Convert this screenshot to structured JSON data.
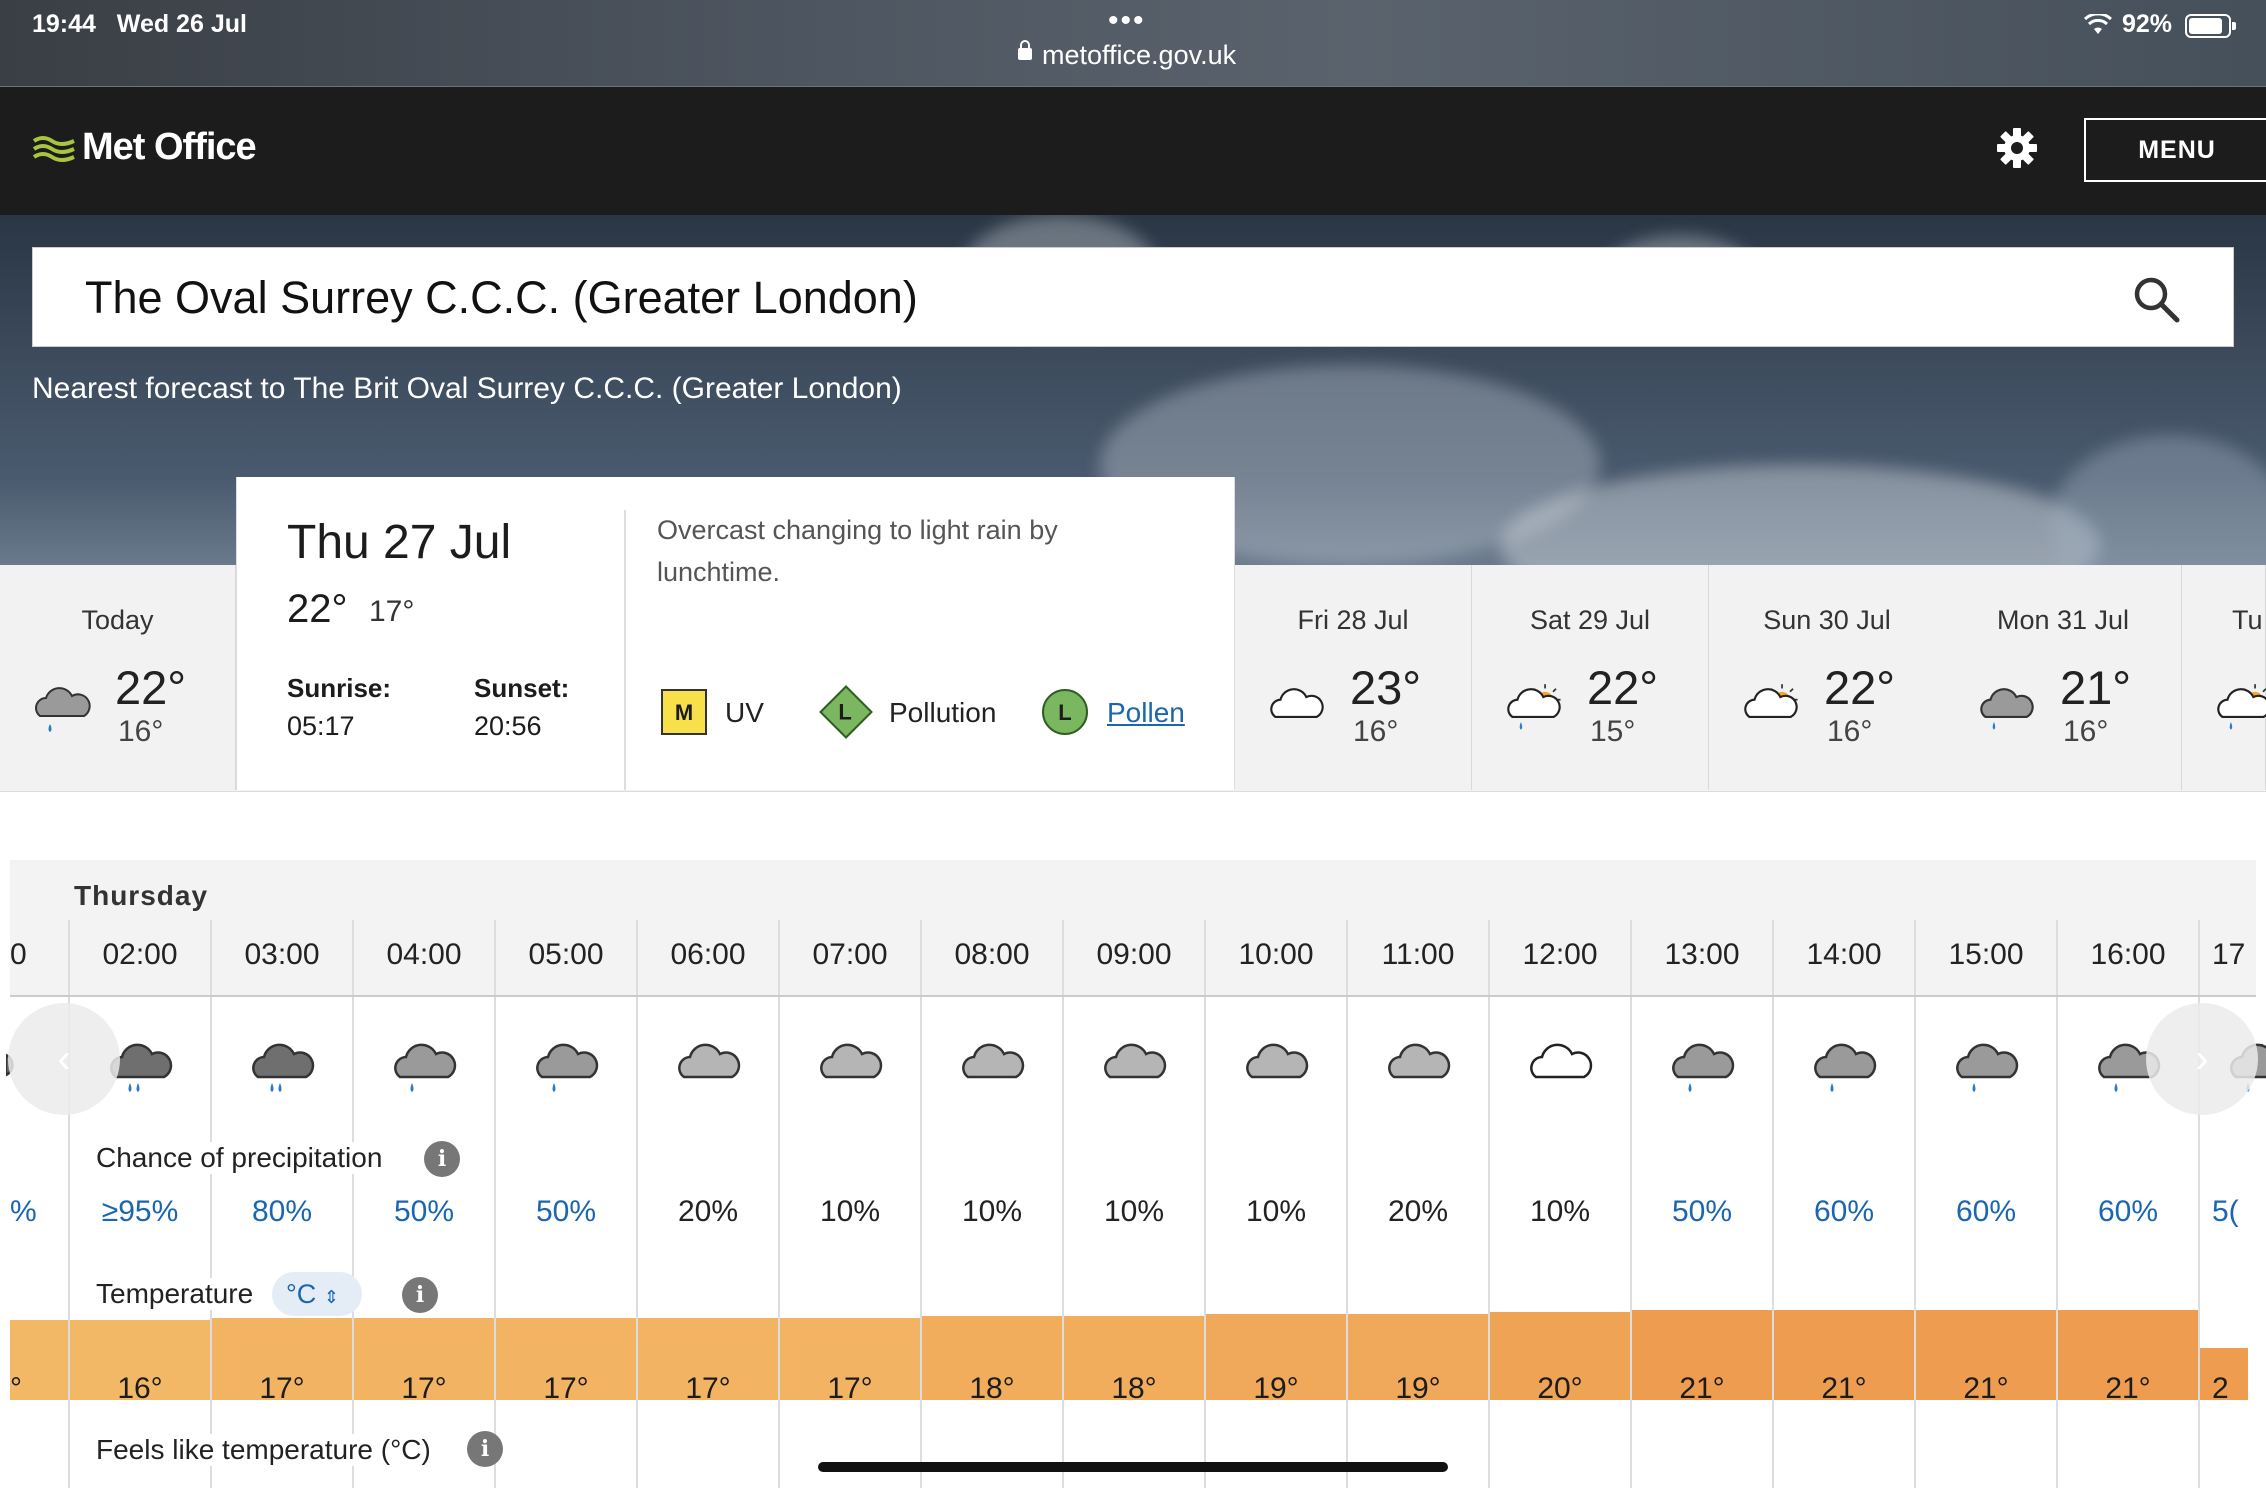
{
  "status_bar": {
    "time": "19:44",
    "date": "Wed 26 Jul",
    "url": "metoffice.gov.uk",
    "battery": "92%",
    "battery_level": 0.92,
    "dots": "•••"
  },
  "header": {
    "logo": "Met Office",
    "menu_label": "MENU",
    "brand_color": "#1c1c1c",
    "logo_color": "#a8c540"
  },
  "search": {
    "value": "The Oval Surrey C.C.C. (Greater London)"
  },
  "nearest_text": "Nearest forecast to The Brit Oval Surrey C.C.C. (Greater London)",
  "days": {
    "today": {
      "label": "Today",
      "high": "22°",
      "low": "16°",
      "icon": "light-rain-cloud-icon"
    },
    "selected": {
      "date": "Thu 27 Jul",
      "high": "22°",
      "low": "17°",
      "sunrise_label": "Sunrise:",
      "sunrise": "05:17",
      "sunset_label": "Sunset:",
      "sunset": "20:56",
      "summary": "Overcast changing to light rain by lunchtime.",
      "uv_badge": "M",
      "uv_label": "UV",
      "pollution_badge": "L",
      "pollution_label": "Pollution",
      "pollen_badge": "L",
      "pollen_label": "Pollen"
    },
    "upcoming": [
      {
        "label": "Fri 28 Jul",
        "high": "23°",
        "low": "16°",
        "icon": "cloud-icon"
      },
      {
        "label": "Sat 29 Jul",
        "high": "22°",
        "low": "15°",
        "icon": "sunny-intervals-shower-icon"
      },
      {
        "label": "Sun 30 Jul",
        "high": "22°",
        "low": "16°",
        "icon": "sunny-intervals-icon"
      },
      {
        "label": "Mon 31 Jul",
        "high": "21°",
        "low": "16°",
        "icon": "light-rain-cloud-icon"
      },
      {
        "label": "Tu",
        "high": "",
        "low": "",
        "icon": "sunny-intervals-shower-icon"
      }
    ]
  },
  "hourly": {
    "day_label": "Thursday",
    "precip_label": "Chance of precipitation",
    "temp_label": "Temperature",
    "temp_unit": "°C",
    "feels_label": "Feels like temperature (°C)",
    "info": "i",
    "hours": [
      {
        "time": "0",
        "precip": "%",
        "temp": "°",
        "icon": "partial",
        "pcolor": "#1a66b0",
        "tcolor": "#f2b866"
      },
      {
        "time": "02:00",
        "precip": "≥95%",
        "temp": "16°",
        "icon": "heavy-rain",
        "pcolor": "#1a66b0",
        "tcolor": "#f2b866"
      },
      {
        "time": "03:00",
        "precip": "80%",
        "temp": "17°",
        "icon": "heavy-rain",
        "pcolor": "#1a66b0",
        "tcolor": "#f2b462"
      },
      {
        "time": "04:00",
        "precip": "50%",
        "temp": "17°",
        "icon": "light-rain",
        "pcolor": "#1a66b0",
        "tcolor": "#f2b462"
      },
      {
        "time": "05:00",
        "precip": "50%",
        "temp": "17°",
        "icon": "light-rain",
        "pcolor": "#1a66b0",
        "tcolor": "#f2b462"
      },
      {
        "time": "06:00",
        "precip": "20%",
        "temp": "17°",
        "icon": "overcast",
        "pcolor": "#222222",
        "tcolor": "#f2b462"
      },
      {
        "time": "07:00",
        "precip": "10%",
        "temp": "17°",
        "icon": "overcast",
        "pcolor": "#222222",
        "tcolor": "#f2b462"
      },
      {
        "time": "08:00",
        "precip": "10%",
        "temp": "18°",
        "icon": "overcast",
        "pcolor": "#222222",
        "tcolor": "#f1ad5c"
      },
      {
        "time": "09:00",
        "precip": "10%",
        "temp": "18°",
        "icon": "overcast",
        "pcolor": "#222222",
        "tcolor": "#f1ad5c"
      },
      {
        "time": "10:00",
        "precip": "10%",
        "temp": "19°",
        "icon": "overcast",
        "pcolor": "#222222",
        "tcolor": "#f0a85a"
      },
      {
        "time": "11:00",
        "precip": "20%",
        "temp": "19°",
        "icon": "overcast",
        "pcolor": "#222222",
        "tcolor": "#f0a85a"
      },
      {
        "time": "12:00",
        "precip": "10%",
        "temp": "20°",
        "icon": "cloud",
        "pcolor": "#222222",
        "tcolor": "#efa355"
      },
      {
        "time": "13:00",
        "precip": "50%",
        "temp": "21°",
        "icon": "light-rain",
        "pcolor": "#1a66b0",
        "tcolor": "#ee9d50"
      },
      {
        "time": "14:00",
        "precip": "60%",
        "temp": "21°",
        "icon": "light-rain",
        "pcolor": "#1a66b0",
        "tcolor": "#ee9d50"
      },
      {
        "time": "15:00",
        "precip": "60%",
        "temp": "21°",
        "icon": "light-rain",
        "pcolor": "#1a66b0",
        "tcolor": "#ee9d50"
      },
      {
        "time": "16:00",
        "precip": "60%",
        "temp": "21°",
        "icon": "light-rain",
        "pcolor": "#1a66b0",
        "tcolor": "#ee9d50"
      },
      {
        "time": "17",
        "precip": "5(",
        "temp": "2",
        "icon": "partial-rain",
        "pcolor": "#1a66b0",
        "tcolor": "#ee9d50"
      }
    ]
  }
}
